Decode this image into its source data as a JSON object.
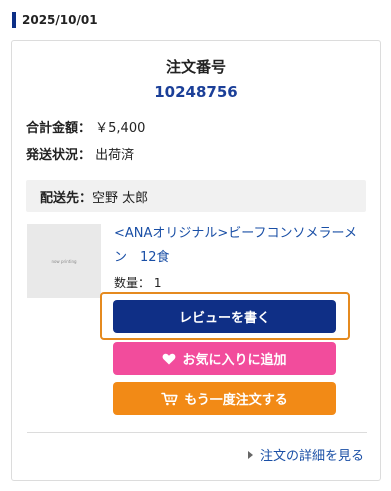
{
  "order_date": "2025/10/01",
  "order": {
    "number_label": "注文番号",
    "number": "10248756",
    "total_label": "合計金額：",
    "total_value": "￥5,400",
    "status_label": "発送状況：",
    "status_value": "出荷済",
    "ship_label": "配送先：",
    "ship_value": "空野 太郎"
  },
  "product": {
    "thumb_text": "now printing",
    "name": "<ANAオリジナル>ビーフコンソメラーメン　12食",
    "qty_label": "数量：",
    "qty_value": "1"
  },
  "buttons": {
    "review": "レビューを書く",
    "favorite": "お気に入りに追加",
    "reorder": "もう一度注文する"
  },
  "detail_link": "注文の詳細を見る",
  "colors": {
    "navy": "#0f2f86",
    "pink": "#f24c9c",
    "orange": "#f28a16",
    "highlight": "#e58a1f",
    "link": "#1a4fa6"
  },
  "icons": {
    "favorite": "heart-icon",
    "reorder": "cart-icon",
    "detail": "triangle-right-icon"
  }
}
